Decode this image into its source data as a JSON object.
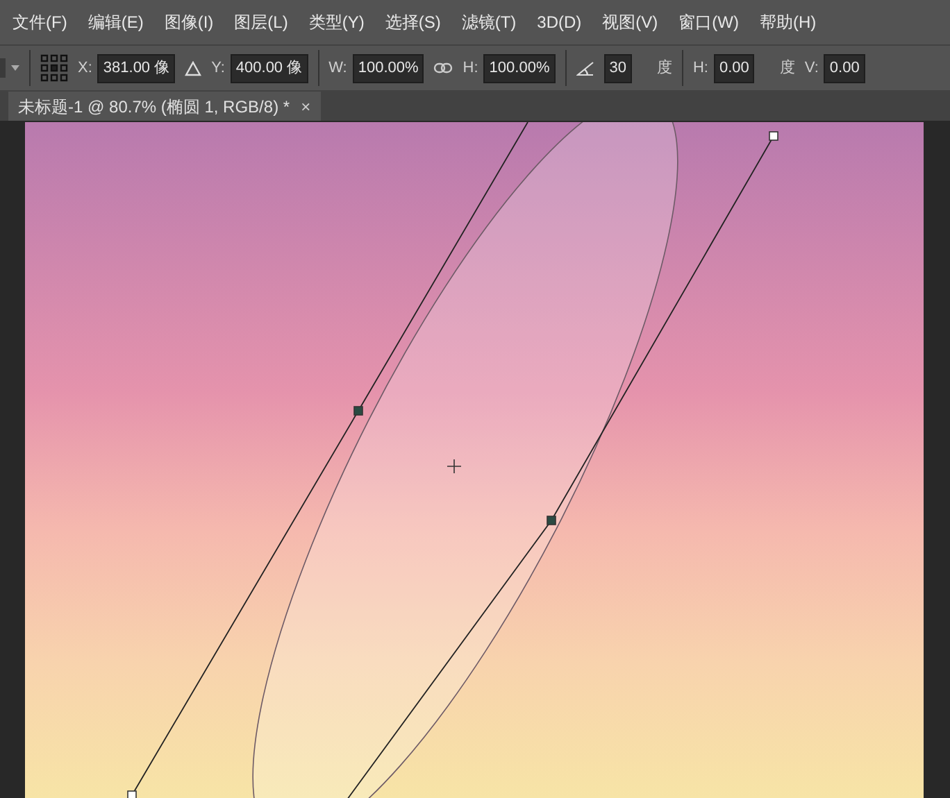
{
  "menu": [
    "文件(F)",
    "编辑(E)",
    "图像(I)",
    "图层(L)",
    "类型(Y)",
    "选择(S)",
    "滤镜(T)",
    "3D(D)",
    "视图(V)",
    "窗口(W)",
    "帮助(H)"
  ],
  "options": [
    {
      "kind": "field",
      "label": "X:",
      "value": "381.00 像"
    },
    {
      "kind": "delta"
    },
    {
      "kind": "field",
      "label": "Y:",
      "value": "400.00 像"
    },
    {
      "kind": "sep"
    },
    {
      "kind": "field",
      "label": "W:",
      "value": "100.00%"
    },
    {
      "kind": "link"
    },
    {
      "kind": "field",
      "label": "H:",
      "value": "100.00%"
    },
    {
      "kind": "sep"
    },
    {
      "kind": "angle"
    },
    {
      "kind": "field",
      "value": "30",
      "unit": "度"
    },
    {
      "kind": "sep"
    },
    {
      "kind": "field",
      "label": "H:",
      "value": "0.00",
      "unit": "度"
    },
    {
      "kind": "field",
      "label": "V:",
      "value": "0.00"
    }
  ],
  "document_tab": {
    "title": "未标题-1 @ 80.7% (椭圆 1, RGB/8) *",
    "close": "×"
  }
}
